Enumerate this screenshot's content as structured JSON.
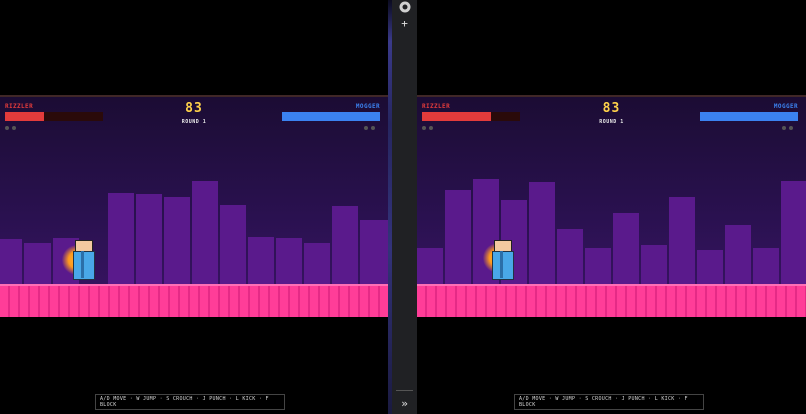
{
  "game": {
    "player1": {
      "name": "RIZZLER",
      "health": 0.4,
      "color": "#e33b3b",
      "name_color": "#e33b3b"
    },
    "player2": {
      "name": "MOGGER",
      "health": 1.0,
      "color": "#3b82f0",
      "name_color": "#3b82f0"
    },
    "timer": "83",
    "round_label": "ROUND 1",
    "controls_text": "A/D MOVE · W JUMP · S CROUCH · J PUNCH · L KICK · F BLOCK"
  },
  "right_view": {
    "player1": {
      "name": "RIZZLER",
      "health": 0.7
    },
    "player2": {
      "name": "MOGGER",
      "health": 1.0
    },
    "timer": "83",
    "round_label": "ROUND 1",
    "controls_text": "A/D MOVE · W JUMP · S CROUCH · J PUNCH · L KICK · F BLOCK"
  },
  "sidebar": {
    "top_icon": "extension-icon",
    "add_icon": "plus-icon",
    "expand_icon": "double-chevron-right-icon",
    "add_label": "+",
    "expand_label": "»"
  }
}
